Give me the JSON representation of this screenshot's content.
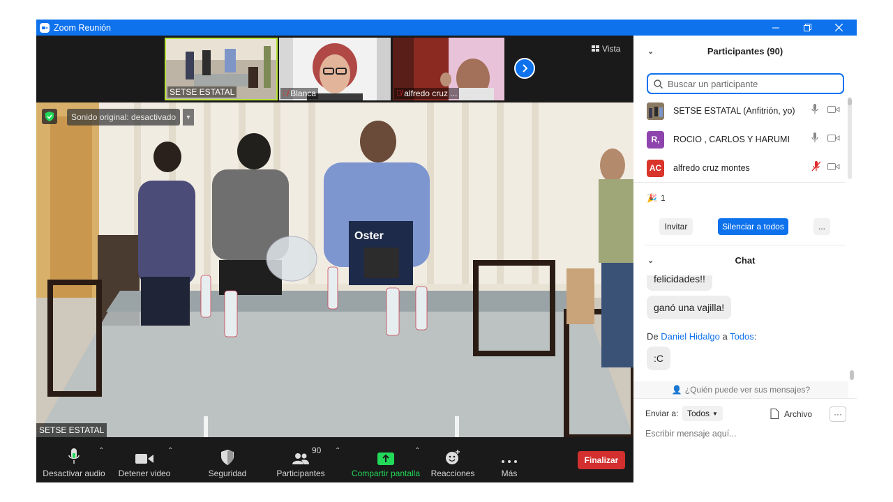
{
  "window": {
    "title": "Zoom Reunión",
    "controls": [
      "minimize-icon",
      "restore-icon",
      "close-icon"
    ]
  },
  "strip": {
    "thumbnails": [
      {
        "name": "SETSE ESTATAL",
        "muted": false
      },
      {
        "name": "Blanca",
        "muted": true
      },
      {
        "name": "alfredo cruz ...",
        "muted": true
      }
    ],
    "next_icon": "chevron-right-icon",
    "view_label": "Vista"
  },
  "main_video": {
    "sound_label": "Sonido original: desactivado",
    "speaker_name": "SETSE ESTATAL"
  },
  "toolbar": {
    "mute_label": "Desactivar audio",
    "video_label": "Detener video",
    "security_label": "Seguridad",
    "participants_label": "Participantes",
    "participants_count": "90",
    "share_label": "Compartir pantalla",
    "reactions_label": "Reacciones",
    "more_label": "Más",
    "end_label": "Finalizar",
    "colors": {
      "share": "#23d959",
      "end": "#d32f2f"
    }
  },
  "participants_panel": {
    "title": "Participantes (90)",
    "search_placeholder": "Buscar un participante",
    "list": [
      {
        "name": "SETSE ESTATAL (Anfitrión, yo)",
        "avatar": "",
        "avatar_color": "#5a4a3a",
        "mic_muted": false
      },
      {
        "name": "ROCIO , CARLOS Y HARUMI",
        "avatar": "R,",
        "avatar_color": "#8e44ad",
        "mic_muted": false
      },
      {
        "name": "alfredo cruz montes",
        "avatar": "AC",
        "avatar_color": "#d9352b",
        "mic_muted": true
      }
    ],
    "reaction_count": "1",
    "invite_label": "Invitar",
    "mute_all_label": "Silenciar a todos",
    "more_label": "..."
  },
  "chat": {
    "title": "Chat",
    "messages": [
      {
        "text": "felicidades!!"
      },
      {
        "text": "ganó una vajilla!"
      }
    ],
    "from_prefix": "De",
    "from_name": "Daniel Hidalgo",
    "to_word": "a",
    "to_name": "Todos",
    "last_message": ":C",
    "who_can_see": "¿Quién puede ver sus mensajes?",
    "send_to_label": "Enviar a:",
    "send_to_value": "Todos",
    "file_label": "Archivo",
    "input_placeholder": "Escribir mensaje aquí..."
  }
}
